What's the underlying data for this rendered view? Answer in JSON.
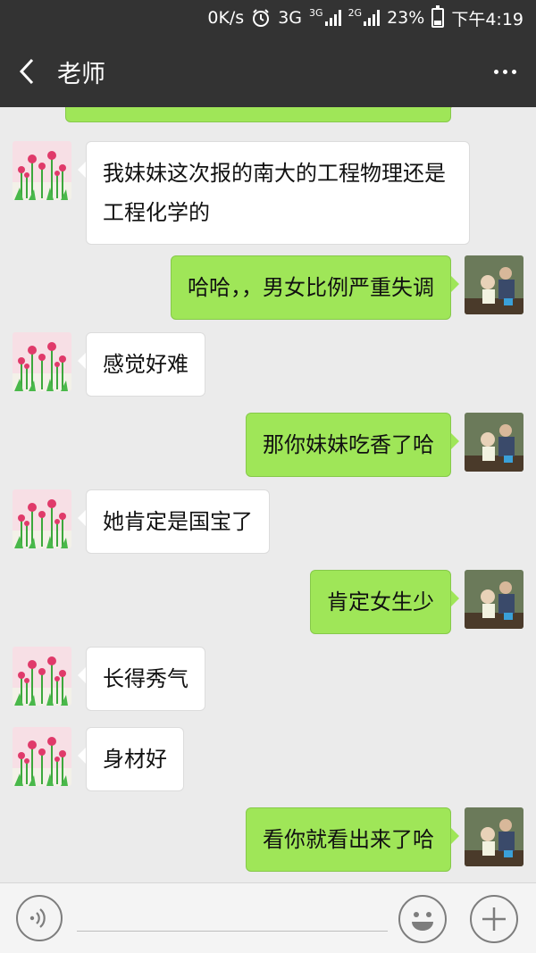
{
  "status_bar": {
    "speed": "0K/s",
    "network_primary": "3G",
    "network_small_1": "3G",
    "network_small_2": "2G",
    "battery": "23%",
    "time": "下午4:19"
  },
  "header": {
    "title": "老师"
  },
  "messages": [
    {
      "side": "in",
      "text": "我妹妹这次报的南大的工程物理还是工程化学的"
    },
    {
      "side": "out",
      "text": "哈哈，，男女比例严重失调"
    },
    {
      "side": "in",
      "text": "感觉好难"
    },
    {
      "side": "out",
      "text": "那你妹妹吃香了哈"
    },
    {
      "side": "in",
      "text": "她肯定是国宝了"
    },
    {
      "side": "out",
      "text": "肯定女生少"
    },
    {
      "side": "in",
      "text": "长得秀气"
    },
    {
      "side": "in",
      "text": "身材好"
    },
    {
      "side": "out",
      "text": "看你就看出来了哈"
    }
  ],
  "input_bar": {
    "voice_icon": "voice-icon",
    "emoji_icon": "emoji-icon",
    "plus_icon": "plus-icon"
  },
  "colors": {
    "header_bg": "#333333",
    "chat_bg": "#ebebeb",
    "out_bubble": "#9fe658",
    "in_bubble": "#ffffff"
  }
}
